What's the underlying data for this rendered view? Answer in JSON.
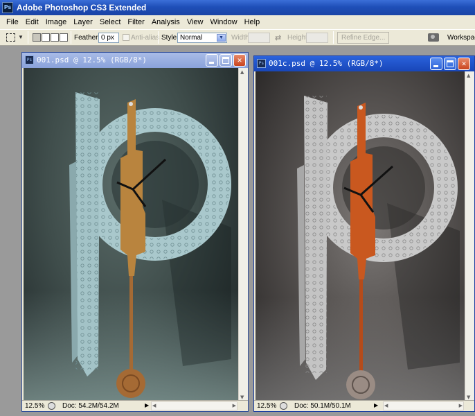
{
  "app": {
    "title": "Adobe Photoshop CS3 Extended",
    "logo": "Ps"
  },
  "menu": [
    "File",
    "Edit",
    "Image",
    "Layer",
    "Select",
    "Filter",
    "Analysis",
    "View",
    "Window",
    "Help"
  ],
  "options": {
    "feather_label": "Feather:",
    "feather_value": "0 px",
    "antialias_label": "Anti-alias",
    "style_label": "Style:",
    "style_value": "Normal",
    "width_label": "Width:",
    "height_label": "Height:",
    "refine_label": "Refine Edge...",
    "workspace_label": "Workspace"
  },
  "documents": [
    {
      "title": "001.psd @ 12.5% (RGB/8*)",
      "zoom": "12.5%",
      "doc_size": "Doc: 54.2M/54.2M",
      "active": false
    },
    {
      "title": "001c.psd @ 12.5% (RGB/8*)",
      "zoom": "12.5%",
      "doc_size": "Doc: 50.1M/50.1M",
      "active": true
    }
  ],
  "colors": {
    "titlebar": "#1f4fb8",
    "metal_teal": "#a9c8cc",
    "metal_silver": "#c9c9c9",
    "wood_warm": "#b9843e",
    "wood_orange": "#c9581f"
  }
}
